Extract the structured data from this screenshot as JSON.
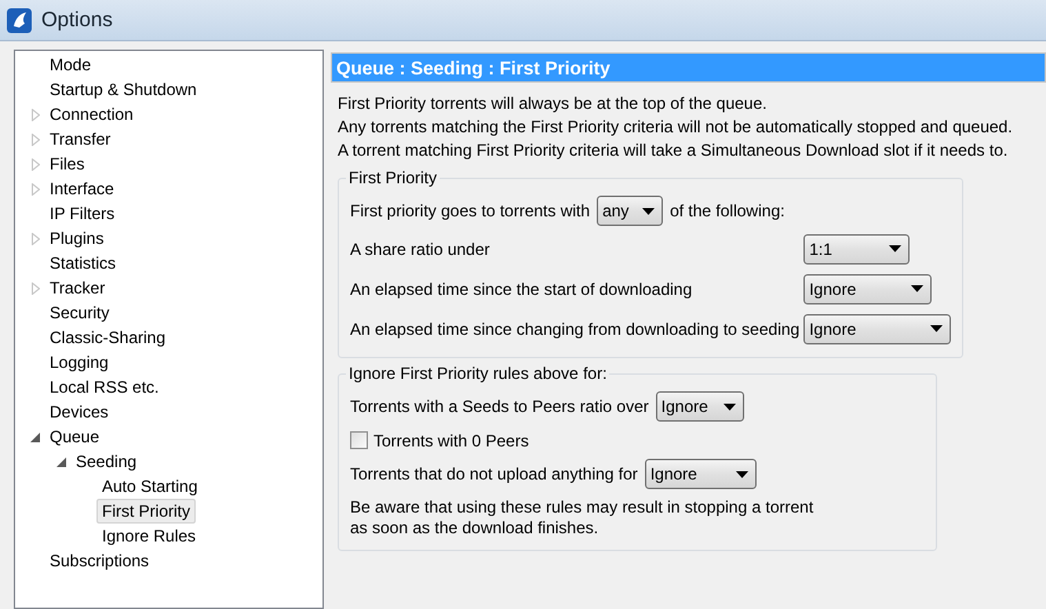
{
  "window": {
    "title": "Options"
  },
  "sidebar": {
    "items": [
      {
        "label": "Mode",
        "selected": false
      },
      {
        "label": "Startup & Shutdown",
        "selected": false
      },
      {
        "label": "Connection",
        "expanded": false,
        "selected": false
      },
      {
        "label": "Transfer",
        "expanded": false,
        "selected": false
      },
      {
        "label": "Files",
        "expanded": false,
        "selected": false
      },
      {
        "label": "Interface",
        "expanded": false,
        "selected": false
      },
      {
        "label": "IP Filters",
        "selected": false
      },
      {
        "label": "Plugins",
        "expanded": false,
        "selected": false
      },
      {
        "label": "Statistics",
        "selected": false
      },
      {
        "label": "Tracker",
        "expanded": false,
        "selected": false
      },
      {
        "label": "Security",
        "selected": false
      },
      {
        "label": "Classic-Sharing",
        "selected": false
      },
      {
        "label": "Logging",
        "selected": false
      },
      {
        "label": "Local RSS etc.",
        "selected": false
      },
      {
        "label": "Devices",
        "selected": false
      },
      {
        "label": "Queue",
        "expanded": true,
        "selected": false,
        "children": [
          {
            "label": "Seeding",
            "expanded": true,
            "selected": false,
            "children": [
              {
                "label": "Auto Starting",
                "selected": false
              },
              {
                "label": "First Priority",
                "selected": true
              },
              {
                "label": "Ignore Rules",
                "selected": false
              }
            ]
          }
        ]
      },
      {
        "label": "Subscriptions",
        "selected": false
      }
    ]
  },
  "page": {
    "title": "Queue : Seeding : First Priority",
    "description": [
      "First Priority torrents will always be at the top of the queue.",
      "Any torrents matching the First Priority criteria will not be automatically stopped and queued.",
      "A torrent matching First Priority criteria will take a Simultaneous Download slot if it needs to."
    ],
    "groups": [
      {
        "title": "First Priority",
        "rows": [
          {
            "kind": "inline-select",
            "label": "First priority goes to torrents with",
            "value": "any",
            "suffix": "of the following:"
          },
          {
            "kind": "select",
            "label": "A share ratio under",
            "value": "1:1"
          },
          {
            "kind": "select",
            "label": "An elapsed time since the start of downloading",
            "value": "Ignore"
          },
          {
            "kind": "select",
            "label": "An elapsed time since changing from downloading to seeding",
            "value": "Ignore"
          }
        ]
      },
      {
        "title": "Ignore First Priority rules above for:",
        "rows": [
          {
            "kind": "inline-select",
            "label": "Torrents with a Seeds to Peers ratio over",
            "value": "Ignore"
          },
          {
            "kind": "checkbox",
            "label": "Torrents with 0 Peers",
            "checked": false
          },
          {
            "kind": "inline-select",
            "label": "Torrents that do not upload anything for",
            "value": "Ignore"
          },
          {
            "kind": "note",
            "text": "Be aware that using these rules may result in stopping a torrent\nas soon as the download finishes."
          }
        ]
      }
    ]
  }
}
